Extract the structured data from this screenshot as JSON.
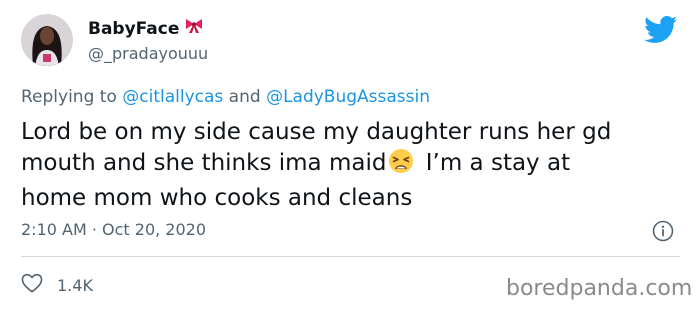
{
  "author": {
    "display_name": "BabyFace",
    "badge_icon": "bow-emoji",
    "handle": "@_pradayouuu"
  },
  "reply": {
    "prefix": "Replying to ",
    "mention_1": "@citlallycas",
    "conjunction": " and ",
    "mention_2": "@LadyBugAssassin"
  },
  "tweet": {
    "line_1": "Lord be on my side cause my daughter runs her gd",
    "line_2a": "mouth and she thinks ima maid",
    "emoji": "weary-face-emoji",
    "line_2b": " I’m a stay at",
    "line_3": "home mom who cooks and cleans"
  },
  "meta": {
    "timestamp": "2:10 AM · Oct 20, 2020"
  },
  "actions": {
    "like_count": "1.4K"
  },
  "watermark": "boredpanda.com",
  "colors": {
    "twitter_blue": "#1da1f2",
    "link_blue": "#1b95e0",
    "secondary_text": "#536471",
    "bow_red": "#e0245e"
  }
}
